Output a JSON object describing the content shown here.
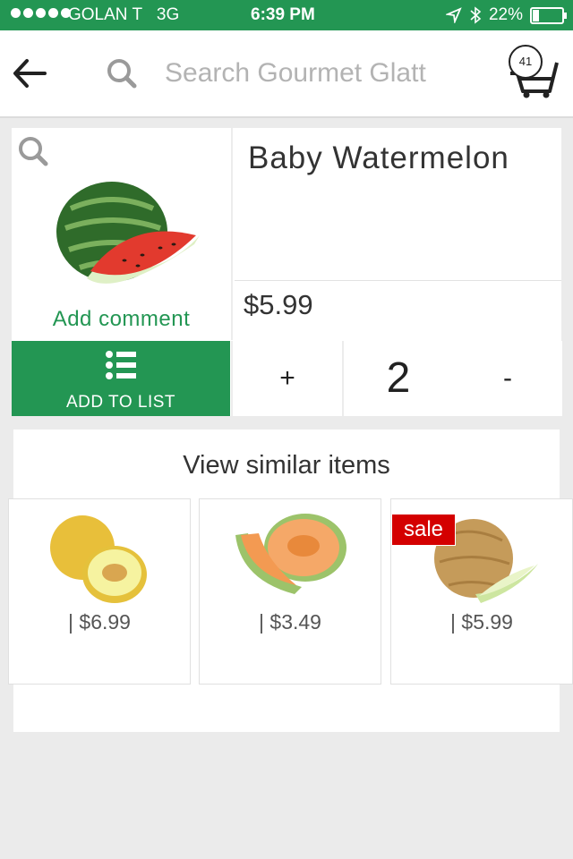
{
  "status_bar": {
    "carrier": "GOLAN T",
    "network": "3G",
    "time": "6:39 PM",
    "battery": "22%"
  },
  "header": {
    "search_placeholder": "Search Gourmet Glatt",
    "cart_count": "41"
  },
  "product": {
    "title": "Baby Watermelon",
    "price": "$5.99",
    "add_comment": "Add comment",
    "add_to_list": "ADD TO LIST",
    "qty_plus": "+",
    "quantity": "2",
    "qty_minus": "-"
  },
  "similar": {
    "title": "View similar items",
    "items": [
      {
        "price": "| $6.99",
        "sale": ""
      },
      {
        "price": "| $3.49",
        "sale": ""
      },
      {
        "price": "| $5.99",
        "sale": "sale"
      }
    ]
  },
  "colors": {
    "brand": "#239653",
    "sale": "#d40000"
  }
}
